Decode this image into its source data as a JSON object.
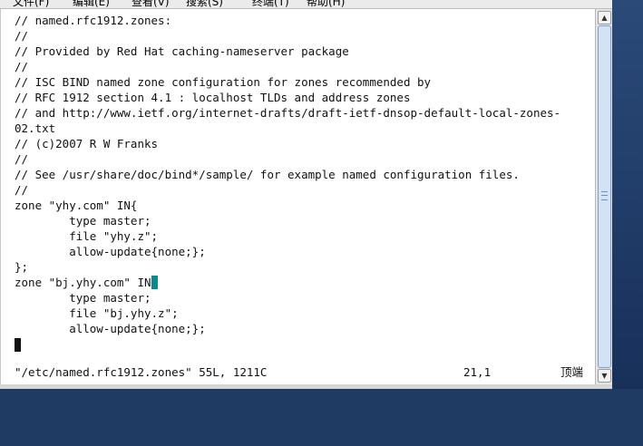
{
  "menubar": {
    "items": [
      "文件(F)",
      "编辑(E)",
      "查看(V)",
      "搜索(S)",
      "终端(T)",
      "帮助(H)"
    ]
  },
  "editor": {
    "lines": [
      "// named.rfc1912.zones:",
      "//",
      "// Provided by Red Hat caching-nameserver package",
      "//",
      "// ISC BIND named zone configuration for zones recommended by",
      "// RFC 1912 section 4.1 : localhost TLDs and address zones",
      "// and http://www.ietf.org/internet-drafts/draft-ietf-dnsop-default-local-zones-",
      "02.txt",
      "// (c)2007 R W Franks",
      "//",
      "// See /usr/share/doc/bind*/sample/ for example named configuration files.",
      "//",
      "zone \"yhy.com\" IN{",
      "        type master;",
      "        file \"yhy.z\";",
      "        allow-update{none;};",
      "};",
      "zone \"bj.yhy.com\" IN",
      "        type master;",
      "        file \"bj.yhy.z\";",
      "        allow-update{none;};",
      ""
    ],
    "highlighted_brace": "{"
  },
  "status": {
    "file": "\"/etc/named.rfc1912.zones\" 55L, 1211C",
    "position": "21,1",
    "scroll": "顶端"
  },
  "scrollbar": {
    "up_icon": "arrow-up",
    "down_icon": "arrow-down"
  }
}
